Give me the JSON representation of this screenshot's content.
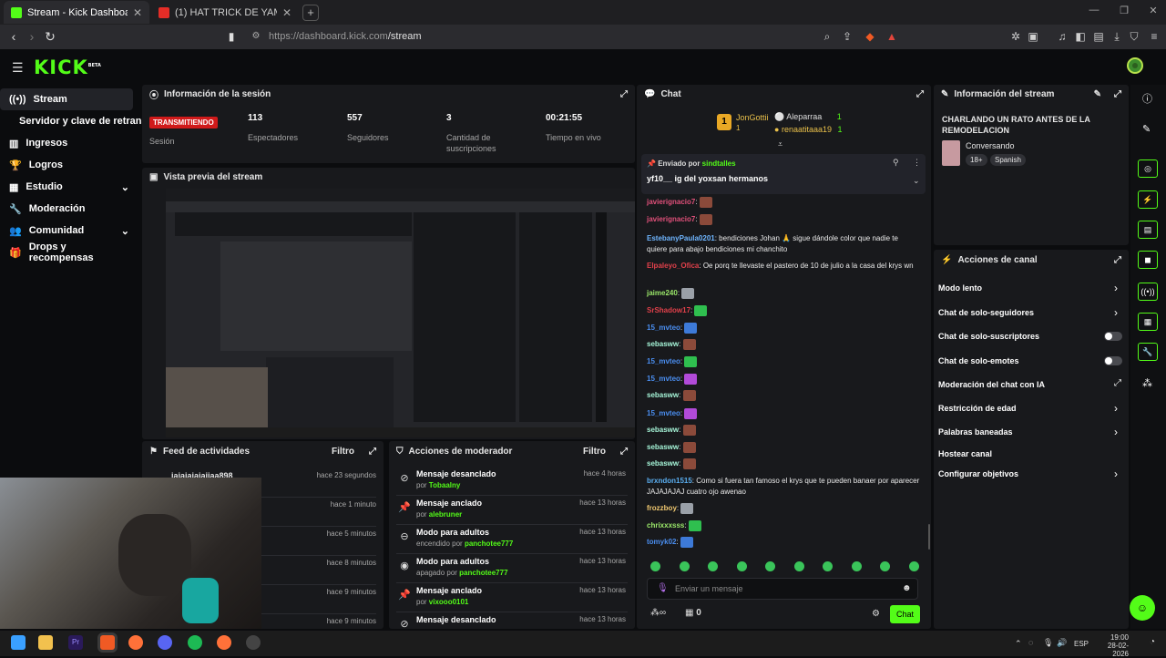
{
  "browser": {
    "tabs": [
      {
        "title": "Stream - Kick Dashboard",
        "favicon_color": "#53fc18"
      },
      {
        "title": "(1) HAT TRICK DE YAMAL, GOLEADA",
        "favicon_color": "#e52d27"
      }
    ],
    "new_tab": "+",
    "url_host": "https://dashboard.kick.com",
    "url_path": "/stream"
  },
  "app": {
    "logo": "KICK",
    "logo_badge": "BETA",
    "accent": "#53fc18"
  },
  "sidebar": {
    "items": [
      {
        "label": "Stream",
        "icon": "broadcast-icon"
      },
      {
        "label": "Servidor y clave de retransm",
        "icon": ""
      },
      {
        "label": "Ingresos",
        "icon": "bars-icon"
      },
      {
        "label": "Logros",
        "icon": "trophy-icon"
      },
      {
        "label": "Estudio",
        "icon": "studio-icon"
      },
      {
        "label": "Moderación",
        "icon": "wrench-icon"
      },
      {
        "label": "Comunidad",
        "icon": "community-icon"
      },
      {
        "label": "Drops y recompensas",
        "icon": "gift-icon"
      }
    ]
  },
  "session": {
    "title": "Información de la sesión",
    "status_badge": "TRANSMITIENDO",
    "status_label": "Sesión",
    "stats": [
      {
        "value": "113",
        "label": "Espectadores"
      },
      {
        "value": "557",
        "label": "Seguidores"
      },
      {
        "value": "3",
        "label": "Cantidad de suscripciones"
      },
      {
        "value": "00:21:55",
        "label": "Tiempo en vivo"
      }
    ]
  },
  "preview": {
    "title": "Vista previa del stream"
  },
  "activity": {
    "title": "Feed de actividades",
    "filter": "Filtro",
    "items": [
      {
        "user": "jajajajajajjaa898",
        "time": "hace 23 segundos"
      },
      {
        "user": "",
        "time": "hace 1 minuto"
      },
      {
        "user": "",
        "time": "hace 5 minutos"
      },
      {
        "user": "",
        "time": "hace 8 minutos"
      },
      {
        "user": "",
        "time": "hace 9 minutos"
      },
      {
        "user": "",
        "time": "hace 9 minutos"
      }
    ]
  },
  "modactions": {
    "title": "Acciones de moderador",
    "filter": "Filtro",
    "items": [
      {
        "icon": "unpin-icon",
        "title": "Mensaje desanclado",
        "prefix": "por",
        "user": "Tobaalny",
        "time": "hace 4 horas"
      },
      {
        "icon": "pin-icon",
        "title": "Mensaje anclado",
        "prefix": "por",
        "user": "alebruner",
        "time": "hace 13 horas"
      },
      {
        "icon": "eye-off-icon",
        "title": "Modo para adultos",
        "prefix": "encendido por",
        "user": "panchotee777",
        "time": "hace 13 horas"
      },
      {
        "icon": "eye-icon",
        "title": "Modo para adultos",
        "prefix": "apagado por",
        "user": "panchotee777",
        "time": "hace 13 horas"
      },
      {
        "icon": "pin-icon",
        "title": "Mensaje anclado",
        "prefix": "por",
        "user": "vixooo0101",
        "time": "hace 13 horas"
      },
      {
        "icon": "unpin-icon",
        "title": "Mensaje desanclado",
        "prefix": "",
        "user": "",
        "time": "hace 13 horas"
      }
    ]
  },
  "chat": {
    "title": "Chat",
    "top_gifter": {
      "rank": "1",
      "name": "JonGottii",
      "count": "1"
    },
    "leaders": [
      {
        "name": "Aleparraa",
        "count": "1"
      },
      {
        "name": "renaatitaaa19",
        "count": "1"
      }
    ],
    "pinned": {
      "label": "Enviado por",
      "user": "sindtalles",
      "text": "yf10__ ig del yoxsan hermanos"
    },
    "messages": [
      {
        "user": "javierignacio7",
        "color": "#e0507a",
        "text": "",
        "emote": "em-brown"
      },
      {
        "user": "javierignacio7",
        "color": "#e0507a",
        "text": "",
        "emote": "em-brown"
      },
      {
        "user": "EstebanyPaula0201",
        "color": "#6fb6ff",
        "text": "bendiciones Johan 🙏 sigue dándole color que nadie te quiere para abajo bendiciones mi chanchito",
        "emote": ""
      },
      {
        "user": "Elpaleyo_Ofica",
        "color": "#e0404a",
        "text": "Oe porq te llevaste el pastero de 10 de julio a la casa del krys wn",
        "emote": ""
      },
      {
        "user": "jaime240",
        "color": "#9be86a",
        "text": "",
        "emote": "em-grey"
      },
      {
        "user": "SrShadow17",
        "color": "#e0404a",
        "text": "",
        "emote": "em-green"
      },
      {
        "user": "15_mvteo",
        "color": "#4a8ef0",
        "text": "",
        "emote": "em-blue"
      },
      {
        "user": "sebasww",
        "color": "#a6f5d8",
        "text": "",
        "emote": "em-brown"
      },
      {
        "user": "15_mvteo",
        "color": "#4a8ef0",
        "text": "",
        "emote": "em-green"
      },
      {
        "user": "15_mvteo",
        "color": "#4a8ef0",
        "text": "",
        "emote": "em-purple"
      },
      {
        "user": "sebasww",
        "color": "#a6f5d8",
        "text": "",
        "emote": "em-brown"
      },
      {
        "user": "15_mvteo",
        "color": "#4a8ef0",
        "text": "",
        "emote": "em-purple"
      },
      {
        "user": "sebasww",
        "color": "#a6f5d8",
        "text": "",
        "emote": "em-brown"
      },
      {
        "user": "sebasww",
        "color": "#a6f5d8",
        "text": "",
        "emote": "em-brown"
      },
      {
        "user": "sebasww",
        "color": "#a6f5d8",
        "text": "",
        "emote": "em-brown"
      },
      {
        "user": "brxndon1515",
        "color": "#5aaef0",
        "text": "Como si fuera tan famoso el krys que te pueden banaer por aparecer JAJAJAJAJ cuatro ojo awenao",
        "emote": ""
      },
      {
        "user": "frozzboy",
        "color": "#f0c870",
        "text": "",
        "emote": "em-grey"
      },
      {
        "user": "chrixxxsss",
        "color": "#9be86a",
        "text": "",
        "emote": "em-green"
      },
      {
        "user": "tomyk02",
        "color": "#4a8ef0",
        "text": "",
        "emote": "em-blue"
      }
    ],
    "input_placeholder": "Enviar un mensaje",
    "infinity": "∞",
    "count": "0",
    "send": "Chat"
  },
  "stream_info": {
    "title": "Información del stream",
    "stream_title": "CHARLANDO UN RATO ANTES DE LA REMODELACION",
    "category": "Conversando",
    "tags": [
      "18+",
      "Spanish"
    ]
  },
  "channel_actions": {
    "title": "Acciones de canal",
    "items": [
      {
        "label": "Modo lento",
        "control": "chevron"
      },
      {
        "label": "Chat de solo-seguidores",
        "control": "chevron"
      },
      {
        "label": "Chat de solo-suscriptores",
        "control": "toggle"
      },
      {
        "label": "Chat de solo-emotes",
        "control": "toggle"
      },
      {
        "label": "Moderación del chat con IA",
        "control": "external"
      },
      {
        "label": "Restricción de edad",
        "control": "chevron"
      },
      {
        "label": "Palabras baneadas",
        "control": "chevron"
      },
      {
        "label": "Hostear canal",
        "control": "none"
      },
      {
        "label": "Configurar objetivos",
        "control": "chevron"
      }
    ]
  },
  "taskbar": {
    "lang": "ESP",
    "time": "19:00",
    "date": "28-02-2026"
  }
}
